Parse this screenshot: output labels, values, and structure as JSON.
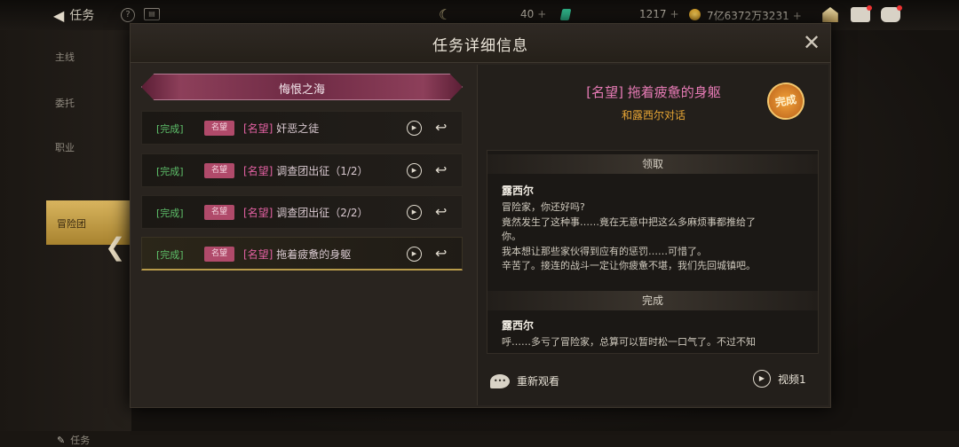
{
  "topbar": {
    "back_label": "任务",
    "resource1": "40",
    "resource2": "1217",
    "resource3": "7亿6372万3231",
    "plus": "+"
  },
  "leftnav": {
    "items": [
      "主线",
      "委托",
      "职业"
    ],
    "active": "冒险团",
    "bottom": "任务"
  },
  "dialog": {
    "title": "任务详细信息",
    "close": "✕"
  },
  "quest_group": {
    "banner": "悔恨之海",
    "rows": [
      {
        "status": "[完成]",
        "tag": "名望",
        "prefix": "[名望]",
        "name": "奸恶之徒"
      },
      {
        "status": "[完成]",
        "tag": "名望",
        "prefix": "[名望]",
        "name": "调查团出征（1/2）"
      },
      {
        "status": "[完成]",
        "tag": "名望",
        "prefix": "[名望]",
        "name": "调查团出征（2/2）"
      },
      {
        "status": "[完成]",
        "tag": "名望",
        "prefix": "[名望]",
        "name": "拖着疲惫的身躯"
      }
    ]
  },
  "detail": {
    "title": "[名望] 拖着疲惫的身躯",
    "subtitle": "和露西尔对话",
    "stamp": "完成",
    "accept_header": "领取",
    "accept_speaker": "露西尔",
    "accept_lines": [
      "冒险家，你还好吗?",
      "竟然发生了这种事……竟在无意中把这么多麻烦事都推给了",
      "你。",
      "我本想让那些家伙得到应有的惩罚……可惜了。",
      "辛苦了。接连的战斗一定让你疲惫不堪，我们先回城镇吧。"
    ],
    "complete_header": "完成",
    "complete_speaker": "露西尔",
    "complete_lines": [
      "呼……多亏了冒险家，总算可以暂时松一口气了。不过不知"
    ],
    "rewatch": "重新观看",
    "video": "视频1"
  }
}
